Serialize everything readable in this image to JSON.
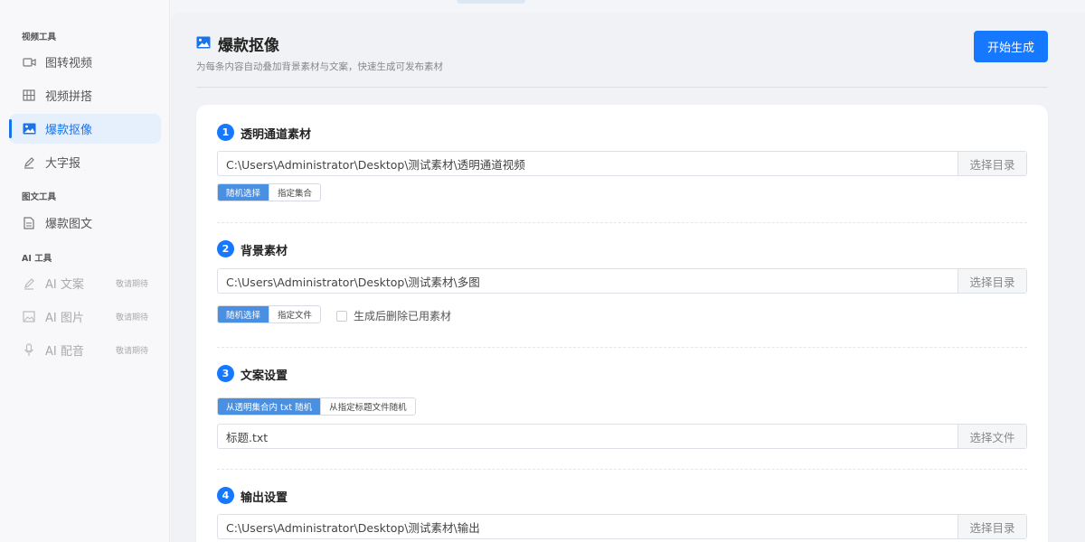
{
  "sidebar": {
    "sections": [
      {
        "title": "视频工具",
        "items": [
          {
            "label": "图转视频",
            "icon": "video-icon"
          },
          {
            "label": "视频拼搭",
            "icon": "grid-icon"
          },
          {
            "label": "爆款抠像",
            "icon": "image-icon",
            "active": true
          },
          {
            "label": "大字报",
            "icon": "pen-icon"
          }
        ]
      },
      {
        "title": "图文工具",
        "items": [
          {
            "label": "爆款图文",
            "icon": "document-icon"
          }
        ]
      },
      {
        "title": "AI 工具",
        "items": [
          {
            "label": "AI 文案",
            "icon": "pen-icon",
            "badge": "敬请期待"
          },
          {
            "label": "AI 图片",
            "icon": "image-icon",
            "badge": "敬请期待"
          },
          {
            "label": "AI 配音",
            "icon": "mic-icon",
            "badge": "敬请期待"
          }
        ]
      }
    ]
  },
  "header": {
    "title": "爆款抠像",
    "subtitle": "为每条内容自动叠加背景素材与文案，快速生成可发布素材",
    "start_button": "开始生成"
  },
  "steps": [
    {
      "num": "1",
      "title": "透明通道素材",
      "path": "C:\\Users\\Administrator\\Desktop\\测试素材\\透明通道视频",
      "pick": "选择目录",
      "options": [
        "随机选择",
        "指定集合"
      ]
    },
    {
      "num": "2",
      "title": "背景素材",
      "path": "C:\\Users\\Administrator\\Desktop\\测试素材\\多图",
      "pick": "选择目录",
      "options": [
        "随机选择",
        "指定文件"
      ],
      "checkbox": "生成后删除已用素材"
    },
    {
      "num": "3",
      "title": "文案设置",
      "path": "标题.txt",
      "pick": "选择文件",
      "options": [
        "从透明集合内 txt 随机",
        "从指定标题文件随机"
      ]
    },
    {
      "num": "4",
      "title": "输出设置",
      "path": "C:\\Users\\Administrator\\Desktop\\测试素材\\输出",
      "pick": "选择目录"
    }
  ],
  "colors": {
    "accent": "#1677ff",
    "active_bg": "#e6effc",
    "segment_on": "#4a90e2"
  }
}
